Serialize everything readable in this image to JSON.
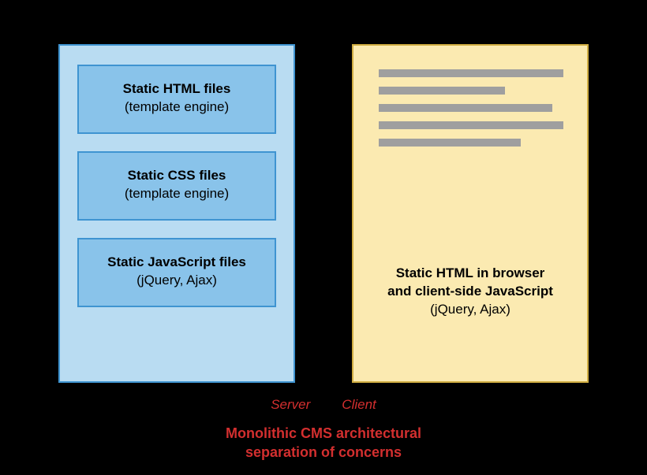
{
  "server": {
    "boxes": [
      {
        "title": "Static HTML files",
        "sub": "(template engine)"
      },
      {
        "title": "Static CSS files",
        "sub": "(template engine)"
      },
      {
        "title": "Static JavaScript files",
        "sub": "(jQuery, Ajax)"
      }
    ]
  },
  "client": {
    "caption_line1": "Static HTML in browser",
    "caption_line2": "and client-side JavaScript",
    "caption_sub": "(jQuery, Ajax)",
    "line_widths": [
      234,
      160,
      220,
      234,
      180
    ]
  },
  "labels": {
    "server": "Server",
    "client": "Client"
  },
  "caption": {
    "line1": "Monolithic CMS architectural",
    "line2": "separation of concerns"
  }
}
